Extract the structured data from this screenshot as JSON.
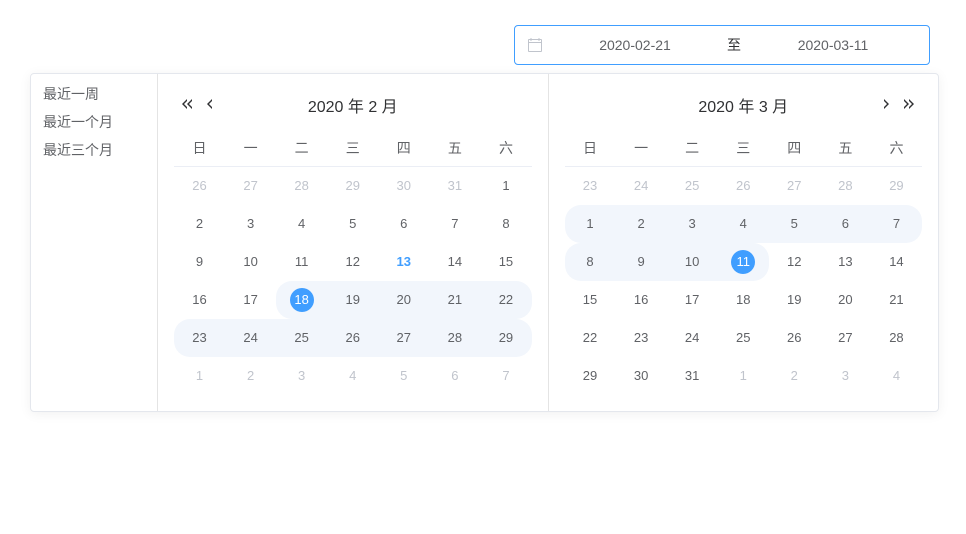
{
  "input": {
    "start": "2020-02-21",
    "separator": "至",
    "end": "2020-03-11"
  },
  "shortcuts": [
    "最近一周",
    "最近一个月",
    "最近三个月"
  ],
  "weekdays": [
    "日",
    "一",
    "二",
    "三",
    "四",
    "五",
    "六"
  ],
  "calendars": [
    {
      "title": "2020 年  2 月",
      "showPrev": true,
      "showNext": false,
      "rows": [
        [
          {
            "d": 26,
            "other": true
          },
          {
            "d": 27,
            "other": true
          },
          {
            "d": 28,
            "other": true
          },
          {
            "d": 29,
            "other": true
          },
          {
            "d": 30,
            "other": true
          },
          {
            "d": 31,
            "other": true
          },
          {
            "d": 1
          }
        ],
        [
          {
            "d": 2
          },
          {
            "d": 3
          },
          {
            "d": 4
          },
          {
            "d": 5
          },
          {
            "d": 6
          },
          {
            "d": 7
          },
          {
            "d": 8
          }
        ],
        [
          {
            "d": 9
          },
          {
            "d": 10
          },
          {
            "d": 11
          },
          {
            "d": 12
          },
          {
            "d": 13,
            "today": true
          },
          {
            "d": 14
          },
          {
            "d": 15
          }
        ],
        [
          {
            "d": 16
          },
          {
            "d": 17
          },
          {
            "d": 18,
            "selected": true,
            "inRange": true,
            "startEdge": true
          },
          {
            "d": 19,
            "inRange": true
          },
          {
            "d": 20,
            "inRange": true
          },
          {
            "d": 21,
            "inRange": true
          },
          {
            "d": 22,
            "inRange": true,
            "endEdge": true
          }
        ],
        [
          {
            "d": 23,
            "inRange": true,
            "startEdge": true
          },
          {
            "d": 24,
            "inRange": true
          },
          {
            "d": 25,
            "inRange": true
          },
          {
            "d": 26,
            "inRange": true
          },
          {
            "d": 27,
            "inRange": true
          },
          {
            "d": 28,
            "inRange": true
          },
          {
            "d": 29,
            "inRange": true,
            "endEdge": true
          }
        ],
        [
          {
            "d": 1,
            "other": true
          },
          {
            "d": 2,
            "other": true
          },
          {
            "d": 3,
            "other": true
          },
          {
            "d": 4,
            "other": true
          },
          {
            "d": 5,
            "other": true
          },
          {
            "d": 6,
            "other": true
          },
          {
            "d": 7,
            "other": true
          }
        ]
      ]
    },
    {
      "title": "2020 年  3 月",
      "showPrev": false,
      "showNext": true,
      "rows": [
        [
          {
            "d": 23,
            "other": true
          },
          {
            "d": 24,
            "other": true
          },
          {
            "d": 25,
            "other": true
          },
          {
            "d": 26,
            "other": true
          },
          {
            "d": 27,
            "other": true
          },
          {
            "d": 28,
            "other": true
          },
          {
            "d": 29,
            "other": true
          }
        ],
        [
          {
            "d": 1,
            "inRange": true,
            "startEdge": true
          },
          {
            "d": 2,
            "inRange": true
          },
          {
            "d": 3,
            "inRange": true
          },
          {
            "d": 4,
            "inRange": true
          },
          {
            "d": 5,
            "inRange": true
          },
          {
            "d": 6,
            "inRange": true
          },
          {
            "d": 7,
            "inRange": true,
            "endEdge": true
          }
        ],
        [
          {
            "d": 8,
            "inRange": true,
            "startEdge": true
          },
          {
            "d": 9,
            "inRange": true
          },
          {
            "d": 10,
            "inRange": true
          },
          {
            "d": 11,
            "selected": true,
            "inRange": true,
            "endEdge": true
          },
          {
            "d": 12
          },
          {
            "d": 13
          },
          {
            "d": 14
          }
        ],
        [
          {
            "d": 15
          },
          {
            "d": 16
          },
          {
            "d": 17
          },
          {
            "d": 18
          },
          {
            "d": 19
          },
          {
            "d": 20
          },
          {
            "d": 21
          }
        ],
        [
          {
            "d": 22
          },
          {
            "d": 23
          },
          {
            "d": 24
          },
          {
            "d": 25
          },
          {
            "d": 26
          },
          {
            "d": 27
          },
          {
            "d": 28
          }
        ],
        [
          {
            "d": 29
          },
          {
            "d": 30
          },
          {
            "d": 31
          },
          {
            "d": 1,
            "other": true
          },
          {
            "d": 2,
            "other": true
          },
          {
            "d": 3,
            "other": true
          },
          {
            "d": 4,
            "other": true
          }
        ]
      ]
    }
  ]
}
